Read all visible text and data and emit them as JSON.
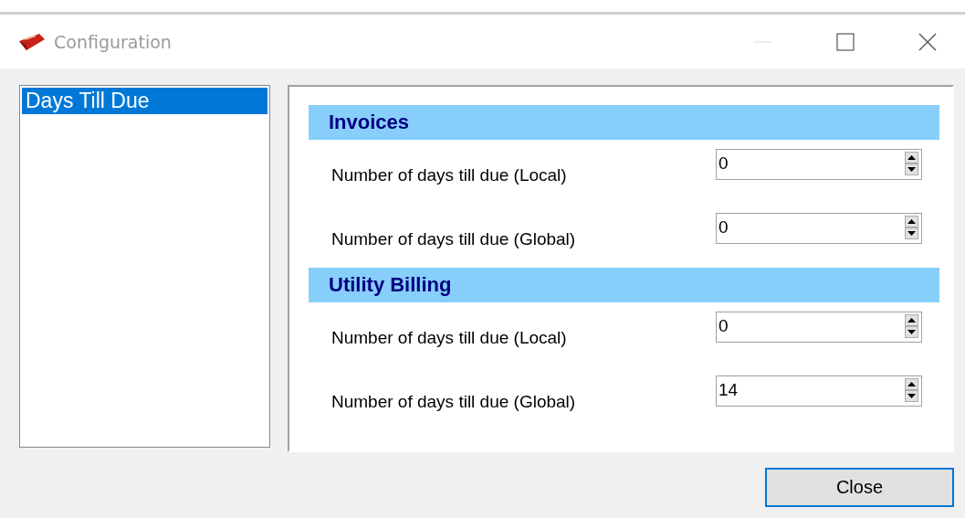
{
  "window": {
    "title": "Configuration"
  },
  "sidebar": {
    "items": [
      {
        "label": "Days Till Due",
        "selected": true
      }
    ]
  },
  "sections": [
    {
      "title": "Invoices",
      "fields": [
        {
          "label": "Number of days till due (Local)",
          "value": "0"
        },
        {
          "label": "Number of days till due (Global)",
          "value": "0"
        }
      ]
    },
    {
      "title": "Utility Billing",
      "fields": [
        {
          "label": "Number of days till due (Local)",
          "value": "0"
        },
        {
          "label": "Number of days till due (Global)",
          "value": "14"
        }
      ]
    }
  ],
  "buttons": [
    {
      "label": "Close"
    }
  ]
}
